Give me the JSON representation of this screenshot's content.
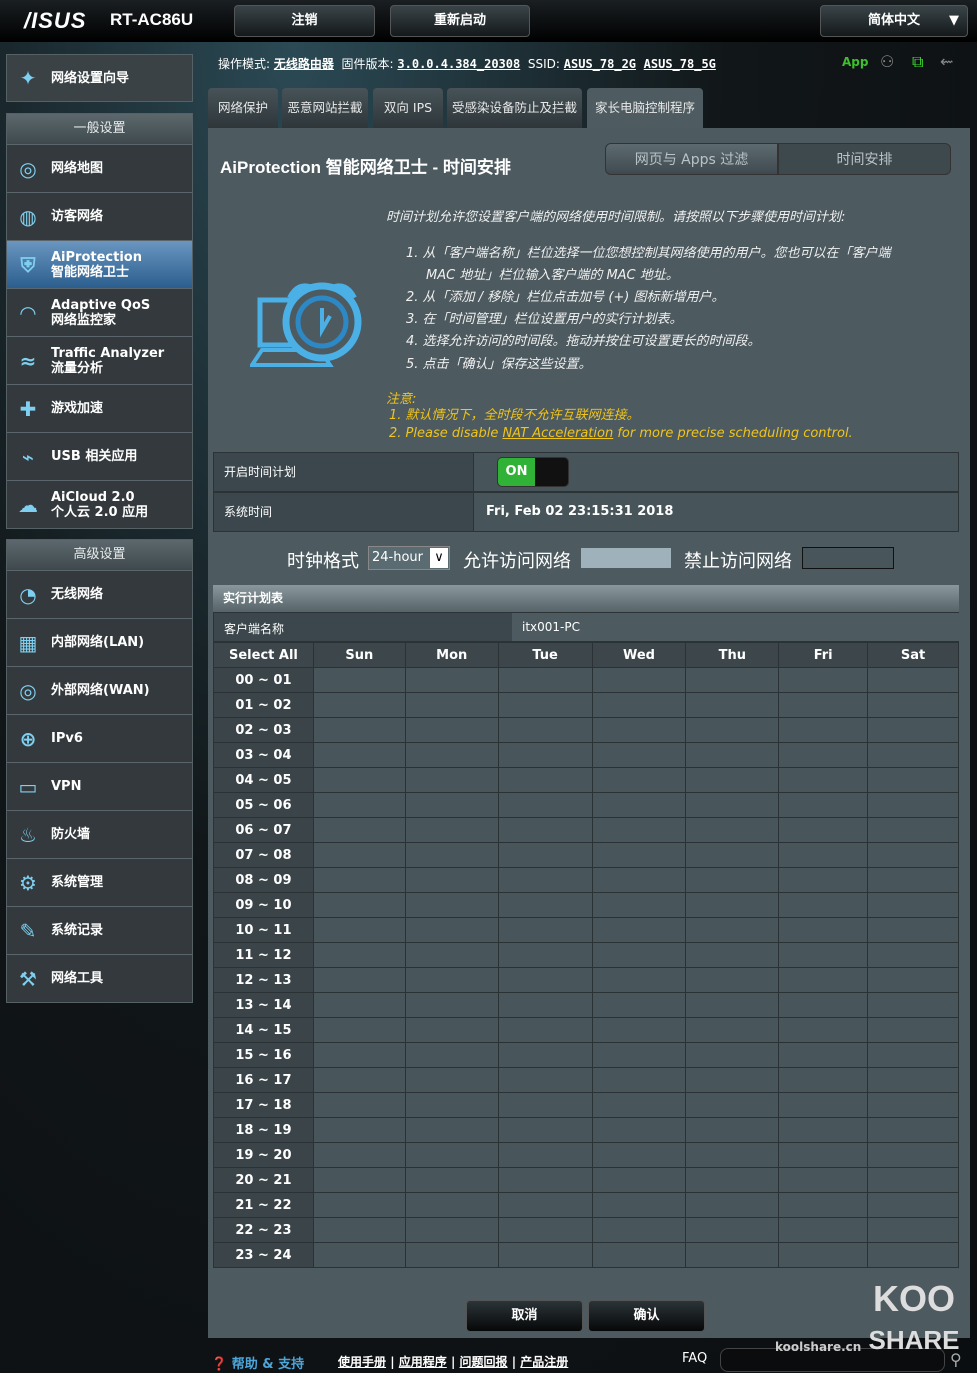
{
  "header": {
    "logo": "/ISUS",
    "model": "RT-AC86U",
    "logout": "注销",
    "reboot": "重新启动",
    "language": "简体中文"
  },
  "info": {
    "mode_label": "操作模式:",
    "mode": "无线路由器",
    "fw_label": "固件版本:",
    "fw": "3.0.0.4.384_20308",
    "ssid_label": "SSID:",
    "ssid_2g": "ASUS_78_2G",
    "ssid_5g": "ASUS_78_5G",
    "app": "App"
  },
  "sidebar": {
    "wizard": "网络设置向导",
    "general_title": "一般设置",
    "general": [
      {
        "l1": "网络地图",
        "l2": "",
        "icon": "globe-icon",
        "g": "◎"
      },
      {
        "l1": "访客网络",
        "l2": "",
        "icon": "guest-network-icon",
        "g": "◍"
      },
      {
        "l1": "AiProtection",
        "l2": "智能网络卫士",
        "icon": "shield-lock-icon",
        "g": "⛨",
        "active": true
      },
      {
        "l1": "Adaptive QoS",
        "l2": "网络监控家",
        "icon": "speedometer-icon",
        "g": "◠"
      },
      {
        "l1": "Traffic Analyzer",
        "l2": "流量分析",
        "icon": "traffic-analyzer-icon",
        "g": "≈"
      },
      {
        "l1": "游戏加速",
        "l2": "",
        "icon": "gamepad-icon",
        "g": "✚"
      },
      {
        "l1": "USB 相关应用",
        "l2": "",
        "icon": "usb-icon",
        "g": "⌁"
      },
      {
        "l1": "AiCloud 2.0",
        "l2": "个人云 2.0 应用",
        "icon": "cloud-icon",
        "g": "☁"
      }
    ],
    "advanced_title": "高级设置",
    "advanced": [
      {
        "l1": "无线网络",
        "icon": "wireless-icon",
        "g": "◔"
      },
      {
        "l1": "内部网络(LAN)",
        "icon": "lan-icon",
        "g": "▦"
      },
      {
        "l1": "外部网络(WAN)",
        "icon": "wan-globe-icon",
        "g": "◎"
      },
      {
        "l1": "IPv6",
        "icon": "ipv6-icon",
        "g": "⊕"
      },
      {
        "l1": "VPN",
        "icon": "vpn-icon",
        "g": "▭"
      },
      {
        "l1": "防火墙",
        "icon": "firewall-icon",
        "g": "♨"
      },
      {
        "l1": "系统管理",
        "icon": "gear-icon",
        "g": "⚙"
      },
      {
        "l1": "系统记录",
        "icon": "log-icon",
        "g": "✎"
      },
      {
        "l1": "网络工具",
        "icon": "tools-icon",
        "g": "⚒"
      }
    ]
  },
  "tabs": [
    "网络保护",
    "恶意网站拦截",
    "双向 IPS",
    "受感染设备防止及拦截",
    "家长电脑控制程序"
  ],
  "main": {
    "title": "AiProtection 智能网络卫士 - 时间安排",
    "seg_web": "网页与 Apps 过滤",
    "seg_time": "时间安排",
    "intro": "时间计划允许您设置客户端的网络使用时间限制。请按照以下步骤使用时间计划:",
    "steps": [
      "1.  从「客户端名称」栏位选择一位您想控制其网络使用的用户。您也可以在「客户端",
      "MAC 地址」栏位输入客户端的 MAC 地址。",
      "2.  从「添加 / 移除」栏位点击加号 (+) 图标新增用户。",
      "3.  在「时间管理」栏位设置用户的实行计划表。",
      "4.  选择允许访问的时间段。拖动并按住可设置更长的时间段。",
      "5.  点击「确认」保存这些设置。"
    ],
    "note_title": "注意:",
    "note1": "1.  默认情况下，全时段不允许互联网连接。",
    "note2_pre": "2.  Please disable ",
    "note2_link": "NAT Acceleration",
    "note2_post": " for more precise scheduling control.",
    "enable_label": "开启时间计划",
    "enable_state": "ON",
    "systime_label": "系统时间",
    "systime": "Fri, Feb 02 23:15:31 2018",
    "clock_label": "时钟格式",
    "clock_value": "24-hour",
    "allow_label": "允许访问网络",
    "deny_label": "禁止访问网络",
    "table_title": "实行计划表",
    "client_label": "客户端名称",
    "client": "itx001-PC",
    "cols": [
      "Select All",
      "Sun",
      "Mon",
      "Tue",
      "Wed",
      "Thu",
      "Fri",
      "Sat"
    ],
    "rows": [
      "00 ~ 01",
      "01 ~ 02",
      "02 ~ 03",
      "03 ~ 04",
      "04 ~ 05",
      "05 ~ 06",
      "06 ~ 07",
      "07 ~ 08",
      "08 ~ 09",
      "09 ~ 10",
      "10 ~ 11",
      "11 ~ 12",
      "12 ~ 13",
      "13 ~ 14",
      "14 ~ 15",
      "15 ~ 16",
      "16 ~ 17",
      "17 ~ 18",
      "18 ~ 19",
      "19 ~ 20",
      "20 ~ 21",
      "21 ~ 22",
      "22 ~ 23",
      "23 ~ 24"
    ],
    "cancel": "取消",
    "apply": "确认"
  },
  "footer": {
    "help": "帮助 & 支持",
    "links": [
      "使用手册",
      "应用程序",
      "问题回报",
      "产品注册"
    ],
    "faq": "FAQ",
    "watermark": "koolshare.cn",
    "logo": "KOOL SHARE"
  },
  "colors": {
    "accent": "#6a96c0",
    "on": "#2fb236",
    "note": "#f0c419",
    "allow": "#9fb2bb"
  }
}
